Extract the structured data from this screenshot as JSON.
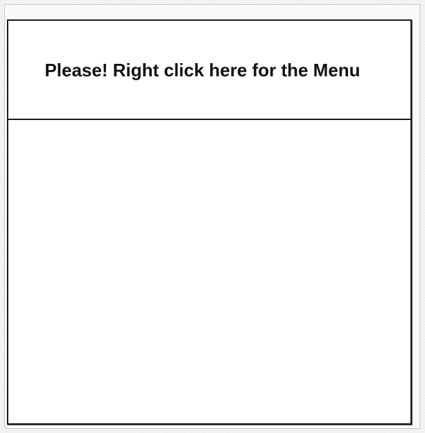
{
  "banner": {
    "label": "Please! Right click here for the Menu"
  }
}
